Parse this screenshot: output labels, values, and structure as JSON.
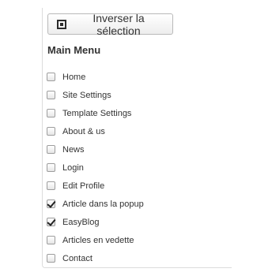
{
  "toolbar": {
    "invert_selection_label": "Inverser la sélection",
    "invert_icon": "checkbox-square-icon"
  },
  "menu": {
    "title": "Main Menu",
    "items": [
      {
        "label": "Home",
        "checked": false
      },
      {
        "label": "Site Settings",
        "checked": false
      },
      {
        "label": "Template Settings",
        "checked": false
      },
      {
        "label": "About & us",
        "checked": false
      },
      {
        "label": "News",
        "checked": false
      },
      {
        "label": "Login",
        "checked": false
      },
      {
        "label": "Edit Profile",
        "checked": false
      },
      {
        "label": "Article dans la popup",
        "checked": true
      },
      {
        "label": "EasyBlog",
        "checked": true
      },
      {
        "label": "Articles en vedette",
        "checked": false
      },
      {
        "label": "Contact",
        "checked": false
      }
    ]
  }
}
